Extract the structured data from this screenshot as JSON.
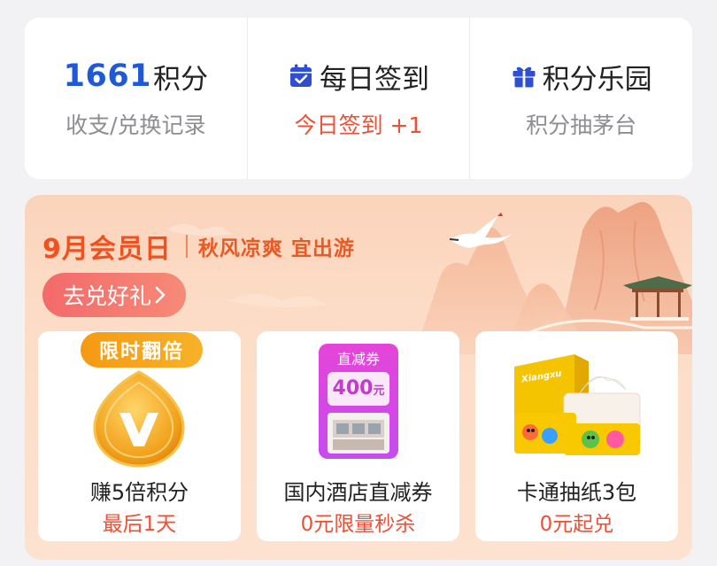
{
  "points_bar": {
    "points": {
      "value": "1661",
      "unit": "积分",
      "sub": "收支/兑换记录"
    },
    "checkin": {
      "icon": "calendar-check-icon",
      "title": "每日签到",
      "sub": "今日签到 +1"
    },
    "park": {
      "icon": "gift-icon",
      "title": "积分乐园",
      "sub": "积分抽茅台"
    }
  },
  "banner": {
    "title": "9月会员日",
    "subtitle": "秋风凉爽 宜出游",
    "button_label": "去兑好礼",
    "button_icon": "chevron-right-icon"
  },
  "cards": [
    {
      "badge": "限时翻倍",
      "name": "赚5倍积分",
      "sub": "最后1天",
      "icon": "gold-v-coin-icon"
    },
    {
      "coupon_label": "直减券",
      "coupon_amount": "400",
      "coupon_unit": "元",
      "name": "国内酒店直减券",
      "sub": "0元限量秒杀"
    },
    {
      "package_brand": "Xiangxu",
      "name": "卡通抽纸3包",
      "sub": "0元起兑"
    }
  ],
  "colors": {
    "points_blue": "#1f5ad6",
    "accent_red": "#ef4f35",
    "banner_orange": "#f0511f",
    "badge_orange": "#f59a12"
  }
}
